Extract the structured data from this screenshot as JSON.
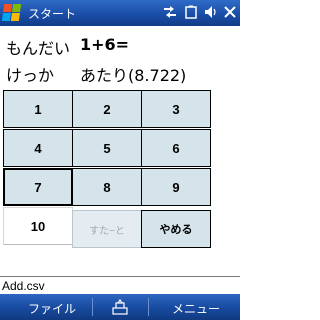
{
  "titlebar": {
    "title": "スタート",
    "icons": [
      "start-windows-logo-icon",
      "connectivity-icon",
      "battery-icon",
      "volume-icon",
      "close-icon"
    ]
  },
  "quiz": {
    "question_label": "もんだい",
    "question_value": "1+6=",
    "result_label": "けっか",
    "result_value": "あたり(8.722)"
  },
  "keypad": {
    "keys": [
      {
        "label": "1"
      },
      {
        "label": "2"
      },
      {
        "label": "3"
      },
      {
        "label": "4"
      },
      {
        "label": "5"
      },
      {
        "label": "6"
      },
      {
        "label": "7",
        "selected": true
      },
      {
        "label": "8"
      },
      {
        "label": "9"
      },
      {
        "label": "10"
      }
    ],
    "start_label": "すた−と",
    "stop_label": "やめる"
  },
  "file_field": {
    "value": "Add.csv"
  },
  "softkeys": {
    "left": "ファイル",
    "right": "メニュー",
    "center_icon": "keyboard-icon"
  },
  "colors": {
    "titlebar": "#1a4ea8",
    "key_bg": "#d5e3ea",
    "disabled_text": "#a8a8a8"
  }
}
